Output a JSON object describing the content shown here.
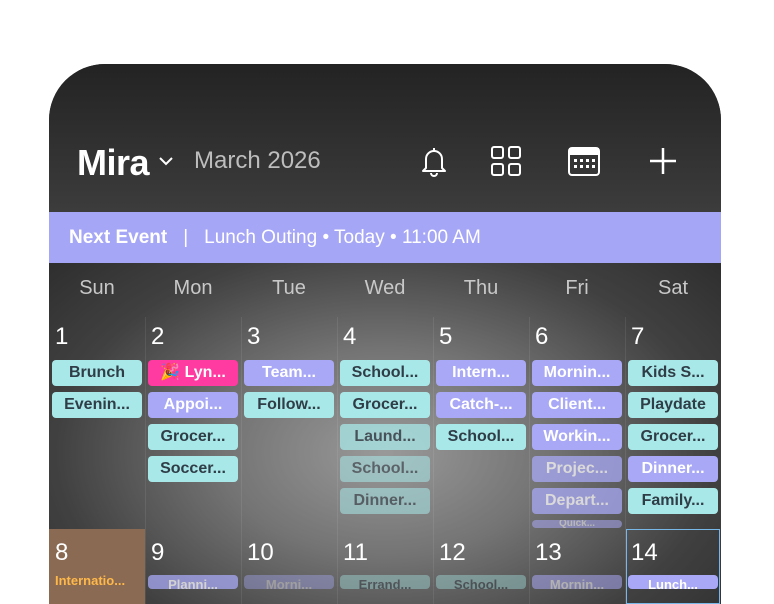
{
  "header": {
    "title": "Mira",
    "month": "March 2026"
  },
  "next_event": {
    "label": "Next Event",
    "separator": "|",
    "value": "Lunch Outing • Today • 11:00 AM"
  },
  "weekdays": [
    "Sun",
    "Mon",
    "Tue",
    "Wed",
    "Thu",
    "Fri",
    "Sat"
  ],
  "week1": {
    "days": [
      "1",
      "2",
      "3",
      "4",
      "5",
      "6",
      "7"
    ],
    "events": {
      "sun": [
        "Brunch",
        "Evenin..."
      ],
      "mon": [
        "🎉 Lyn...",
        "Appoi...",
        "Grocer...",
        "Soccer..."
      ],
      "tue": [
        "Team...",
        "Follow..."
      ],
      "wed": [
        "School...",
        "Grocer...",
        "Laund...",
        "School...",
        "Dinner..."
      ],
      "thu": [
        "Intern...",
        "Catch-...",
        "School..."
      ],
      "fri": [
        "Mornin...",
        "Client...",
        "Workin...",
        "Projec...",
        "Depart...",
        "Quick..."
      ],
      "sat": [
        "Kids S...",
        "Playdate",
        "Grocer...",
        "Dinner...",
        "Family..."
      ]
    }
  },
  "week2": {
    "days": [
      "8",
      "9",
      "10",
      "11",
      "12",
      "13",
      "14"
    ],
    "holiday": "Internatio...",
    "peeks": [
      "Planni...",
      "Morni...",
      "Errand...",
      "School...",
      "Mornin...",
      "Lunch..."
    ]
  },
  "colors": {
    "accent": "#a6a6f6",
    "teal": "#a9e8e8",
    "purple": "#a8a8f6",
    "pink": "#ff3aa0",
    "holiday": "#ffb84a"
  },
  "icons": [
    "chevron-down-icon",
    "bell-icon",
    "grid-icon",
    "calendar-icon",
    "plus-icon"
  ]
}
